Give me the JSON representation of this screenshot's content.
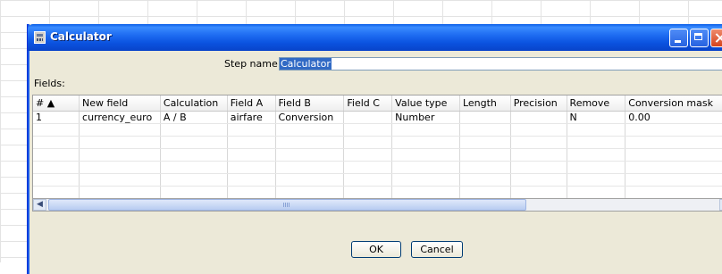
{
  "window": {
    "title": "Calculator",
    "icon": "calculator-icon"
  },
  "step": {
    "label": "Step name",
    "value": "Calculator"
  },
  "fields_label": "Fields:",
  "table": {
    "columns": [
      "#",
      "New field",
      "Calculation",
      "Field A",
      "Field B",
      "Field C",
      "Value type",
      "Length",
      "Precision",
      "Remove",
      "Conversion mask"
    ],
    "rows": [
      [
        "1",
        "currency_euro",
        "A / B",
        "airfare",
        "Conversion",
        "",
        "Number",
        "",
        "",
        "N",
        "0.00"
      ]
    ]
  },
  "buttons": {
    "ok": "OK",
    "cancel": "Cancel"
  }
}
